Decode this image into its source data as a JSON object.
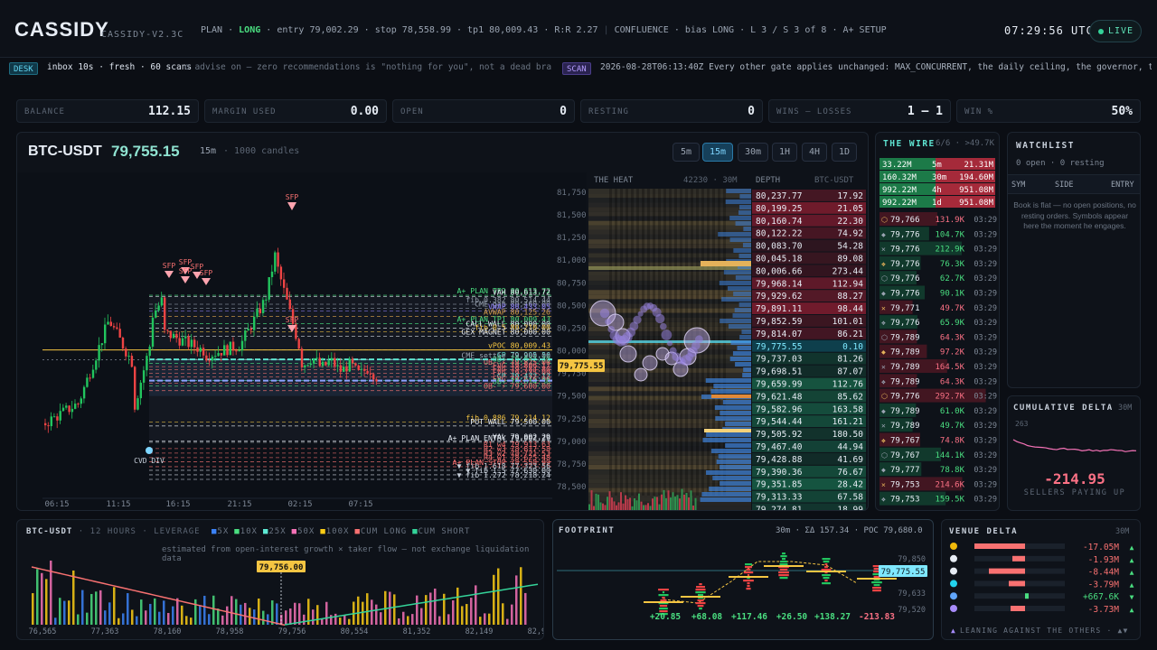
{
  "app": {
    "name": "CASSIDY",
    "version": "CASSIDY-V2.3C",
    "clock": "07:29:56 UTC",
    "live": "LIVE"
  },
  "plan": {
    "prefix": "PLAN ·",
    "side": "LONG",
    "rest": "· entry 79,002.29 · stop 78,558.99 · tp1 80,009.43 · R:R 2.27",
    "confluence": "CONFLUENCE · bias LONG · L 3 / S 3 of 8 · A+ SETUP"
  },
  "ticker": {
    "desk_tag": "DESK",
    "desk_msg": "inbox 10s · fresh · 60 scans",
    "desk_scroll": "o advise on — zero recommendations is \"nothing for you\", not a dead brain",
    "scan_tag": "SCAN",
    "scan_msg": "2026-08-28T06:13:40Z Every other gate applies unchanged: MAX_CONCURRENT, the daily ceiling, the governor, the c"
  },
  "stats": [
    {
      "label": "BALANCE",
      "value": "112.15"
    },
    {
      "label": "MARGIN USED",
      "value": "0.00"
    },
    {
      "label": "OPEN",
      "value": "0"
    },
    {
      "label": "RESTING",
      "value": "0"
    },
    {
      "label": "WINS – LOSSES",
      "value": "1 – 1"
    },
    {
      "label": "WIN %",
      "value": "50%"
    }
  ],
  "chart": {
    "pair": "BTC-USDT",
    "price": "79,755.15",
    "tf": "15m",
    "sub": "· 1000 candles",
    "timeframes": [
      "5m",
      "15m",
      "30m",
      "1H",
      "4H",
      "1D"
    ],
    "active_tf": "15m",
    "heat_label": "THE HEAT",
    "heat_meta": "42230 · 30M",
    "depth_label": "DEPTH",
    "depth_pair": "BTC-USDT",
    "price_tag": "79,775.55",
    "yticks": [
      "81,750",
      "81,500",
      "81,250",
      "81,000",
      "80,750",
      "80,500",
      "80,250",
      "80,000",
      "79,750",
      "79,500",
      "79,250",
      "79,000",
      "78,750",
      "78,500"
    ],
    "xticks": [
      "06:15",
      "11:15",
      "16:15",
      "21:15",
      "02:15",
      "07:15"
    ],
    "levels": [
      {
        "text": "A+ PLAN TP2 80,613.72",
        "c": "#4ade80",
        "p": 80613
      },
      {
        "text": "VAH 80,613.72",
        "c": "#e7edf5",
        "p": 80600
      },
      {
        "text": "CME gap 80,460.00",
        "c": "#9aa4b2",
        "p": 80470
      },
      {
        "text": "fib 0.382 80,514.44",
        "c": "#9aa4b2",
        "p": 80514
      },
      {
        "text": "VWAP 80,433.05",
        "c": "#8b7cf6",
        "p": 80440
      },
      {
        "text": "AVWAP 80,125.26",
        "c": "#d9a14a",
        "p": 80380
      },
      {
        "text": "A+ PLAN TP1 80,009.43",
        "c": "#4ade80",
        "p": 80300
      },
      {
        "text": "CALL WALL 80,000.00",
        "c": "#e7edf5",
        "p": 80250
      },
      {
        "text": "fib 0.5 80,210.00",
        "c": "#f5c542",
        "p": 80210
      },
      {
        "text": "GEX MAGNET 80,000.00",
        "c": "#e7edf5",
        "p": 80160
      },
      {
        "text": "vPOC 80,009.43",
        "c": "#f5c542",
        "p": 80009
      },
      {
        "text": "GP 79,905.56",
        "c": "#5ee3d1",
        "p": 79905
      },
      {
        "text": "OB+ 79,847.30",
        "c": "#4ade80",
        "p": 79860
      },
      {
        "text": "CME settle 79,900.00",
        "c": "#9aa4b2",
        "p": 79900
      },
      {
        "text": "OB- ⚡ 79,825.00",
        "c": "#f87171",
        "p": 79825
      },
      {
        "text": "FVG 79,806.17",
        "c": "#f87171",
        "p": 79790
      },
      {
        "text": "FVG 79,784.80",
        "c": "#f87171",
        "p": 79750
      },
      {
        "text": "FVG 79,735.99",
        "c": "#f87171",
        "p": 79710
      },
      {
        "text": "GP 79,472.12",
        "c": "#5ee3d1",
        "p": 79670
      },
      {
        "text": "FVG 79,676.00",
        "c": "#f87171",
        "p": 79640
      },
      {
        "text": "OB+ 79,614.30",
        "c": "#4ade80",
        "p": 79610
      },
      {
        "text": "OB- ⚡ 79,600.00",
        "c": "#f87171",
        "p": 79560
      },
      {
        "text": "fib 0.886 79,214.12",
        "c": "#f5c542",
        "p": 79214
      },
      {
        "text": "PUT WALL 79,500.00",
        "c": "#e7edf5",
        "p": 79170
      },
      {
        "text": "VAL 79,002.29",
        "c": "#e7edf5",
        "p": 79002
      },
      {
        "text": "A+ PLAN ENTRY 79,002.29",
        "c": "#e7edf5",
        "p": 78990
      },
      {
        "text": "R1 w4 79,913.63",
        "c": "#f87171",
        "p": 78920
      },
      {
        "text": "R2 w3 78,817.58",
        "c": "#f87171",
        "p": 78870
      },
      {
        "text": "R3 w2 78,721.53",
        "c": "#f87171",
        "p": 78820
      },
      {
        "text": "R4 w1 78,625.48",
        "c": "#f87171",
        "p": 78775
      },
      {
        "text": "A+ PLAN STOP 78,558.99",
        "c": "#f87171",
        "p": 78720
      },
      {
        "text": "▼ fib 1.618 77,323.56",
        "c": "#c9d1dc",
        "p": 78680
      },
      {
        "text": "▼ fib 1.5 77,630.00",
        "c": "#c9d1dc",
        "p": 78630
      },
      {
        "text": "▼ fib 1.272 78,218.24",
        "c": "#c9d1dc",
        "p": 78580
      }
    ],
    "sfp_label": "SFP",
    "cvd_label": "CVD DIV",
    "depth": {
      "asks": [
        [
          "80,237.77",
          "17.92"
        ],
        [
          "80,199.25",
          "21.05"
        ],
        [
          "80,160.74",
          "22.30"
        ],
        [
          "80,122.22",
          "74.92"
        ],
        [
          "80,083.70",
          "54.28"
        ],
        [
          "80,045.18",
          "89.08"
        ],
        [
          "80,006.66",
          "273.44"
        ],
        [
          "79,968.14",
          "112.94"
        ],
        [
          "79,929.62",
          "88.27"
        ],
        [
          "79,891.11",
          "98.44"
        ],
        [
          "79,852.59",
          "101.01"
        ],
        [
          "79,814.07",
          "86.21"
        ]
      ],
      "mid": [
        "79,775.55",
        "0.10"
      ],
      "bids": [
        [
          "79,737.03",
          "81.26"
        ],
        [
          "79,698.51",
          "87.07"
        ],
        [
          "79,659.99",
          "112.76"
        ],
        [
          "79,621.48",
          "85.62"
        ],
        [
          "79,582.96",
          "163.58"
        ],
        [
          "79,544.44",
          "161.21"
        ],
        [
          "79,505.92",
          "180.50"
        ],
        [
          "79,467.40",
          "44.94"
        ],
        [
          "79,428.88",
          "41.69"
        ],
        [
          "79,390.36",
          "76.67"
        ],
        [
          "79,351.85",
          "28.42"
        ],
        [
          "79,313.33",
          "67.58"
        ],
        [
          "79,274.81",
          "18.99"
        ]
      ]
    }
  },
  "wire": {
    "title": "THE WIRE",
    "meta": "6/6 · >49.7K",
    "tf": [
      [
        "33.22M",
        "5m",
        "21.31M"
      ],
      [
        "160.32M",
        "30m",
        "194.60M"
      ],
      [
        "992.22M",
        "4h",
        "951.08M"
      ],
      [
        "992.22M",
        "1d",
        "951.08M"
      ]
    ],
    "trades": [
      [
        "79,766",
        "131.9K",
        "03:29",
        "r"
      ],
      [
        "79,776",
        "104.7K",
        "03:29",
        "g"
      ],
      [
        "79,776",
        "212.9K",
        "03:29",
        "g"
      ],
      [
        "79,776",
        "76.3K",
        "03:29",
        "g"
      ],
      [
        "79,776",
        "62.7K",
        "03:29",
        "g"
      ],
      [
        "79,776",
        "90.1K",
        "03:29",
        "g"
      ],
      [
        "79,771",
        "49.7K",
        "03:29",
        "r"
      ],
      [
        "79,776",
        "65.9K",
        "03:29",
        "g"
      ],
      [
        "79,789",
        "64.3K",
        "03:29",
        "r"
      ],
      [
        "79,789",
        "97.2K",
        "03:29",
        "r"
      ],
      [
        "79,789",
        "164.5K",
        "03:29",
        "r"
      ],
      [
        "79,789",
        "64.3K",
        "03:29",
        "r"
      ],
      [
        "79,776",
        "292.7K",
        "03:29",
        "r"
      ],
      [
        "79,789",
        "61.0K",
        "03:29",
        "g"
      ],
      [
        "79,789",
        "49.7K",
        "03:29",
        "g"
      ],
      [
        "79,767",
        "74.8K",
        "03:29",
        "r"
      ],
      [
        "79,767",
        "144.1K",
        "03:29",
        "g"
      ],
      [
        "79,777",
        "78.8K",
        "03:29",
        "g"
      ],
      [
        "79,753",
        "214.6K",
        "03:29",
        "r"
      ],
      [
        "79,753",
        "159.5K",
        "03:29",
        "g"
      ]
    ]
  },
  "watchlist": {
    "title": "WATCHLIST",
    "sub": "0 open · 0 resting",
    "cols": [
      "SYM",
      "SIDE",
      "ENTRY"
    ],
    "empty": "Book is flat — no open positions, no resting orders. Symbols appear here the moment he engages."
  },
  "cumdelta": {
    "title": "CUMULATIVE DELTA",
    "tf": "30M",
    "top": "263",
    "value": "-214.95",
    "sub": "SELLERS PAYING UP"
  },
  "liq": {
    "title": "BTC-USDT",
    "meta": "· 12 HOURS · LEVERAGE",
    "legend": [
      [
        "5X",
        "#3b82f6"
      ],
      [
        "10X",
        "#4ade80"
      ],
      [
        "25X",
        "#5eead4"
      ],
      [
        "50X",
        "#f472b6"
      ],
      [
        "100X",
        "#facc15"
      ],
      [
        "CUM LONG",
        "#f87171"
      ],
      [
        "CUM SHORT",
        "#34d399"
      ]
    ],
    "note": "estimated from open-interest growth × taker flow — not exchange liquidation data",
    "tag": "79,756.00",
    "xticks": [
      "76,565",
      "77,363",
      "78,160",
      "78,958",
      "79,756",
      "80,554",
      "81,352",
      "82,149",
      "82,947"
    ]
  },
  "footprint": {
    "title": "FOOTPRINT",
    "meta": "30m · ΣΔ 157.34 · POC 79,680.0",
    "ylabels": [
      "79,850",
      "79,633",
      "79,520"
    ],
    "tag": "79,775.55",
    "deltas": [
      "+20.85",
      "+68.08",
      "+117.46",
      "+26.50",
      "+138.27",
      "-213.83"
    ]
  },
  "venue": {
    "title": "VENUE DELTA",
    "tf": "30M",
    "rows": [
      [
        "-17.05M",
        "▲",
        "#f87171"
      ],
      [
        "-1.93M",
        "▲",
        "#f87171"
      ],
      [
        "-8.44M",
        "▲",
        "#f87171"
      ],
      [
        "-3.79M",
        "▲",
        "#f87171"
      ],
      [
        "+667.6K",
        "▼",
        "#4ade80"
      ],
      [
        "-3.73M",
        "▲",
        "#f87171"
      ]
    ],
    "footer": "LEANING AGAINST THE OTHERS · ▲▼"
  },
  "colors": {
    "up": "#22c55e",
    "down": "#ef4444",
    "accent": "#5ee3d1",
    "gold": "#f5c542"
  }
}
